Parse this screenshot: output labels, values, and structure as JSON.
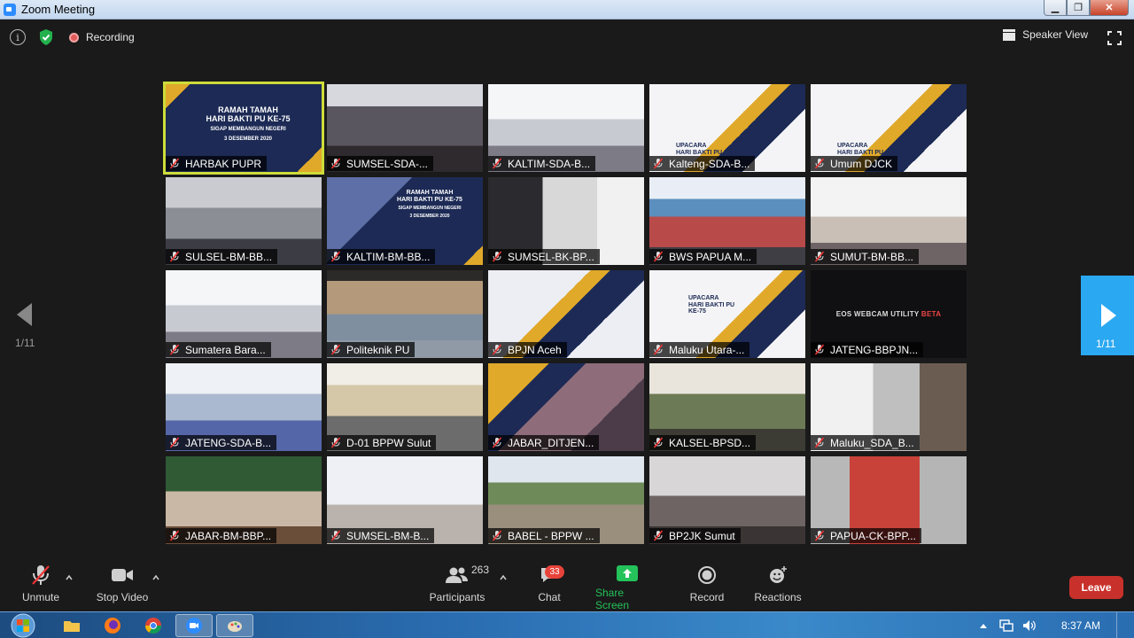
{
  "window": {
    "title": "Zoom Meeting"
  },
  "topbar": {
    "recording_label": "Recording",
    "speaker_view_label": "Speaker View"
  },
  "gallery": {
    "page_indicator": "1/11",
    "tiles": [
      {
        "name": "HARBAK PUPR",
        "scene": "slide-main",
        "active": true
      },
      {
        "name": "SUMSEL-SDA-...",
        "scene": "room-dark"
      },
      {
        "name": "KALTIM-SDA-B...",
        "scene": "hall-white"
      },
      {
        "name": "Kalteng-SDA-B...",
        "scene": "slide-upacara"
      },
      {
        "name": "Umum DJCK",
        "scene": "slide-upacara"
      },
      {
        "name": "SULSEL-BM-BB...",
        "scene": "hall-grey"
      },
      {
        "name": "KALTIM-BM-BB...",
        "scene": "slide-main-small"
      },
      {
        "name": "SUMSEL-BK-BP...",
        "scene": "room-grey"
      },
      {
        "name": "BWS PAPUA M...",
        "scene": "tent-red"
      },
      {
        "name": "SUMUT-BM-BB...",
        "scene": "room-bright"
      },
      {
        "name": "Sumatera Bara...",
        "scene": "hall-white"
      },
      {
        "name": "Politeknik PU",
        "scene": "hall-wood"
      },
      {
        "name": "BPJN Aceh",
        "scene": "slide-plain"
      },
      {
        "name": "Maluku Utara-...",
        "scene": "slide-upacara-ke75"
      },
      {
        "name": "JATENG-BBPJN...",
        "scene": "webcam"
      },
      {
        "name": "JATENG-SDA-B...",
        "scene": "hall-blue"
      },
      {
        "name": "D-01 BPPW Sulut",
        "scene": "room-deco"
      },
      {
        "name": "JABAR_DITJEN...",
        "scene": "crowd"
      },
      {
        "name": "KALSEL-BPSD...",
        "scene": "crowd-green"
      },
      {
        "name": "Maluku_SDA_B...",
        "scene": "room-white-chairs"
      },
      {
        "name": "JABAR-BM-BBP...",
        "scene": "outdoor-people"
      },
      {
        "name": "SUMSEL-BM-B...",
        "scene": "slide-people"
      },
      {
        "name": "BABEL - BPPW ...",
        "scene": "outdoor-field"
      },
      {
        "name": "BP2JK Sumut",
        "scene": "office"
      },
      {
        "name": "PAPUA-CK-BPP...",
        "scene": "papua"
      }
    ],
    "main_slide": {
      "line1": "RAMAH TAMAH",
      "line2": "HARI BAKTI PU KE-75",
      "line3": "SIGAP MEMBANGUN NEGERI",
      "line4": "3 DESEMBER 2020"
    },
    "upacara_text": "UPACARA\nHARI BAKTI PU",
    "upacara_ke75_text": "UPACARA\nHARI BAKTI PU\nKE-75",
    "webcam_text": "EOS WEBCAM UTILITY",
    "webcam_beta": "BETA"
  },
  "toolbar": {
    "unmute_label": "Unmute",
    "stop_video_label": "Stop Video",
    "participants_label": "Participants",
    "participants_count": "263",
    "chat_label": "Chat",
    "chat_badge": "33",
    "share_label": "Share Screen",
    "record_label": "Record",
    "reactions_label": "Reactions",
    "leave_label": "Leave"
  },
  "taskbar": {
    "clock": "8:37 AM"
  },
  "colors": {
    "accent_blue": "#2ba8f2",
    "share_green": "#23c25a",
    "leave_red": "#c8312b",
    "active_outline": "#cddc39"
  }
}
